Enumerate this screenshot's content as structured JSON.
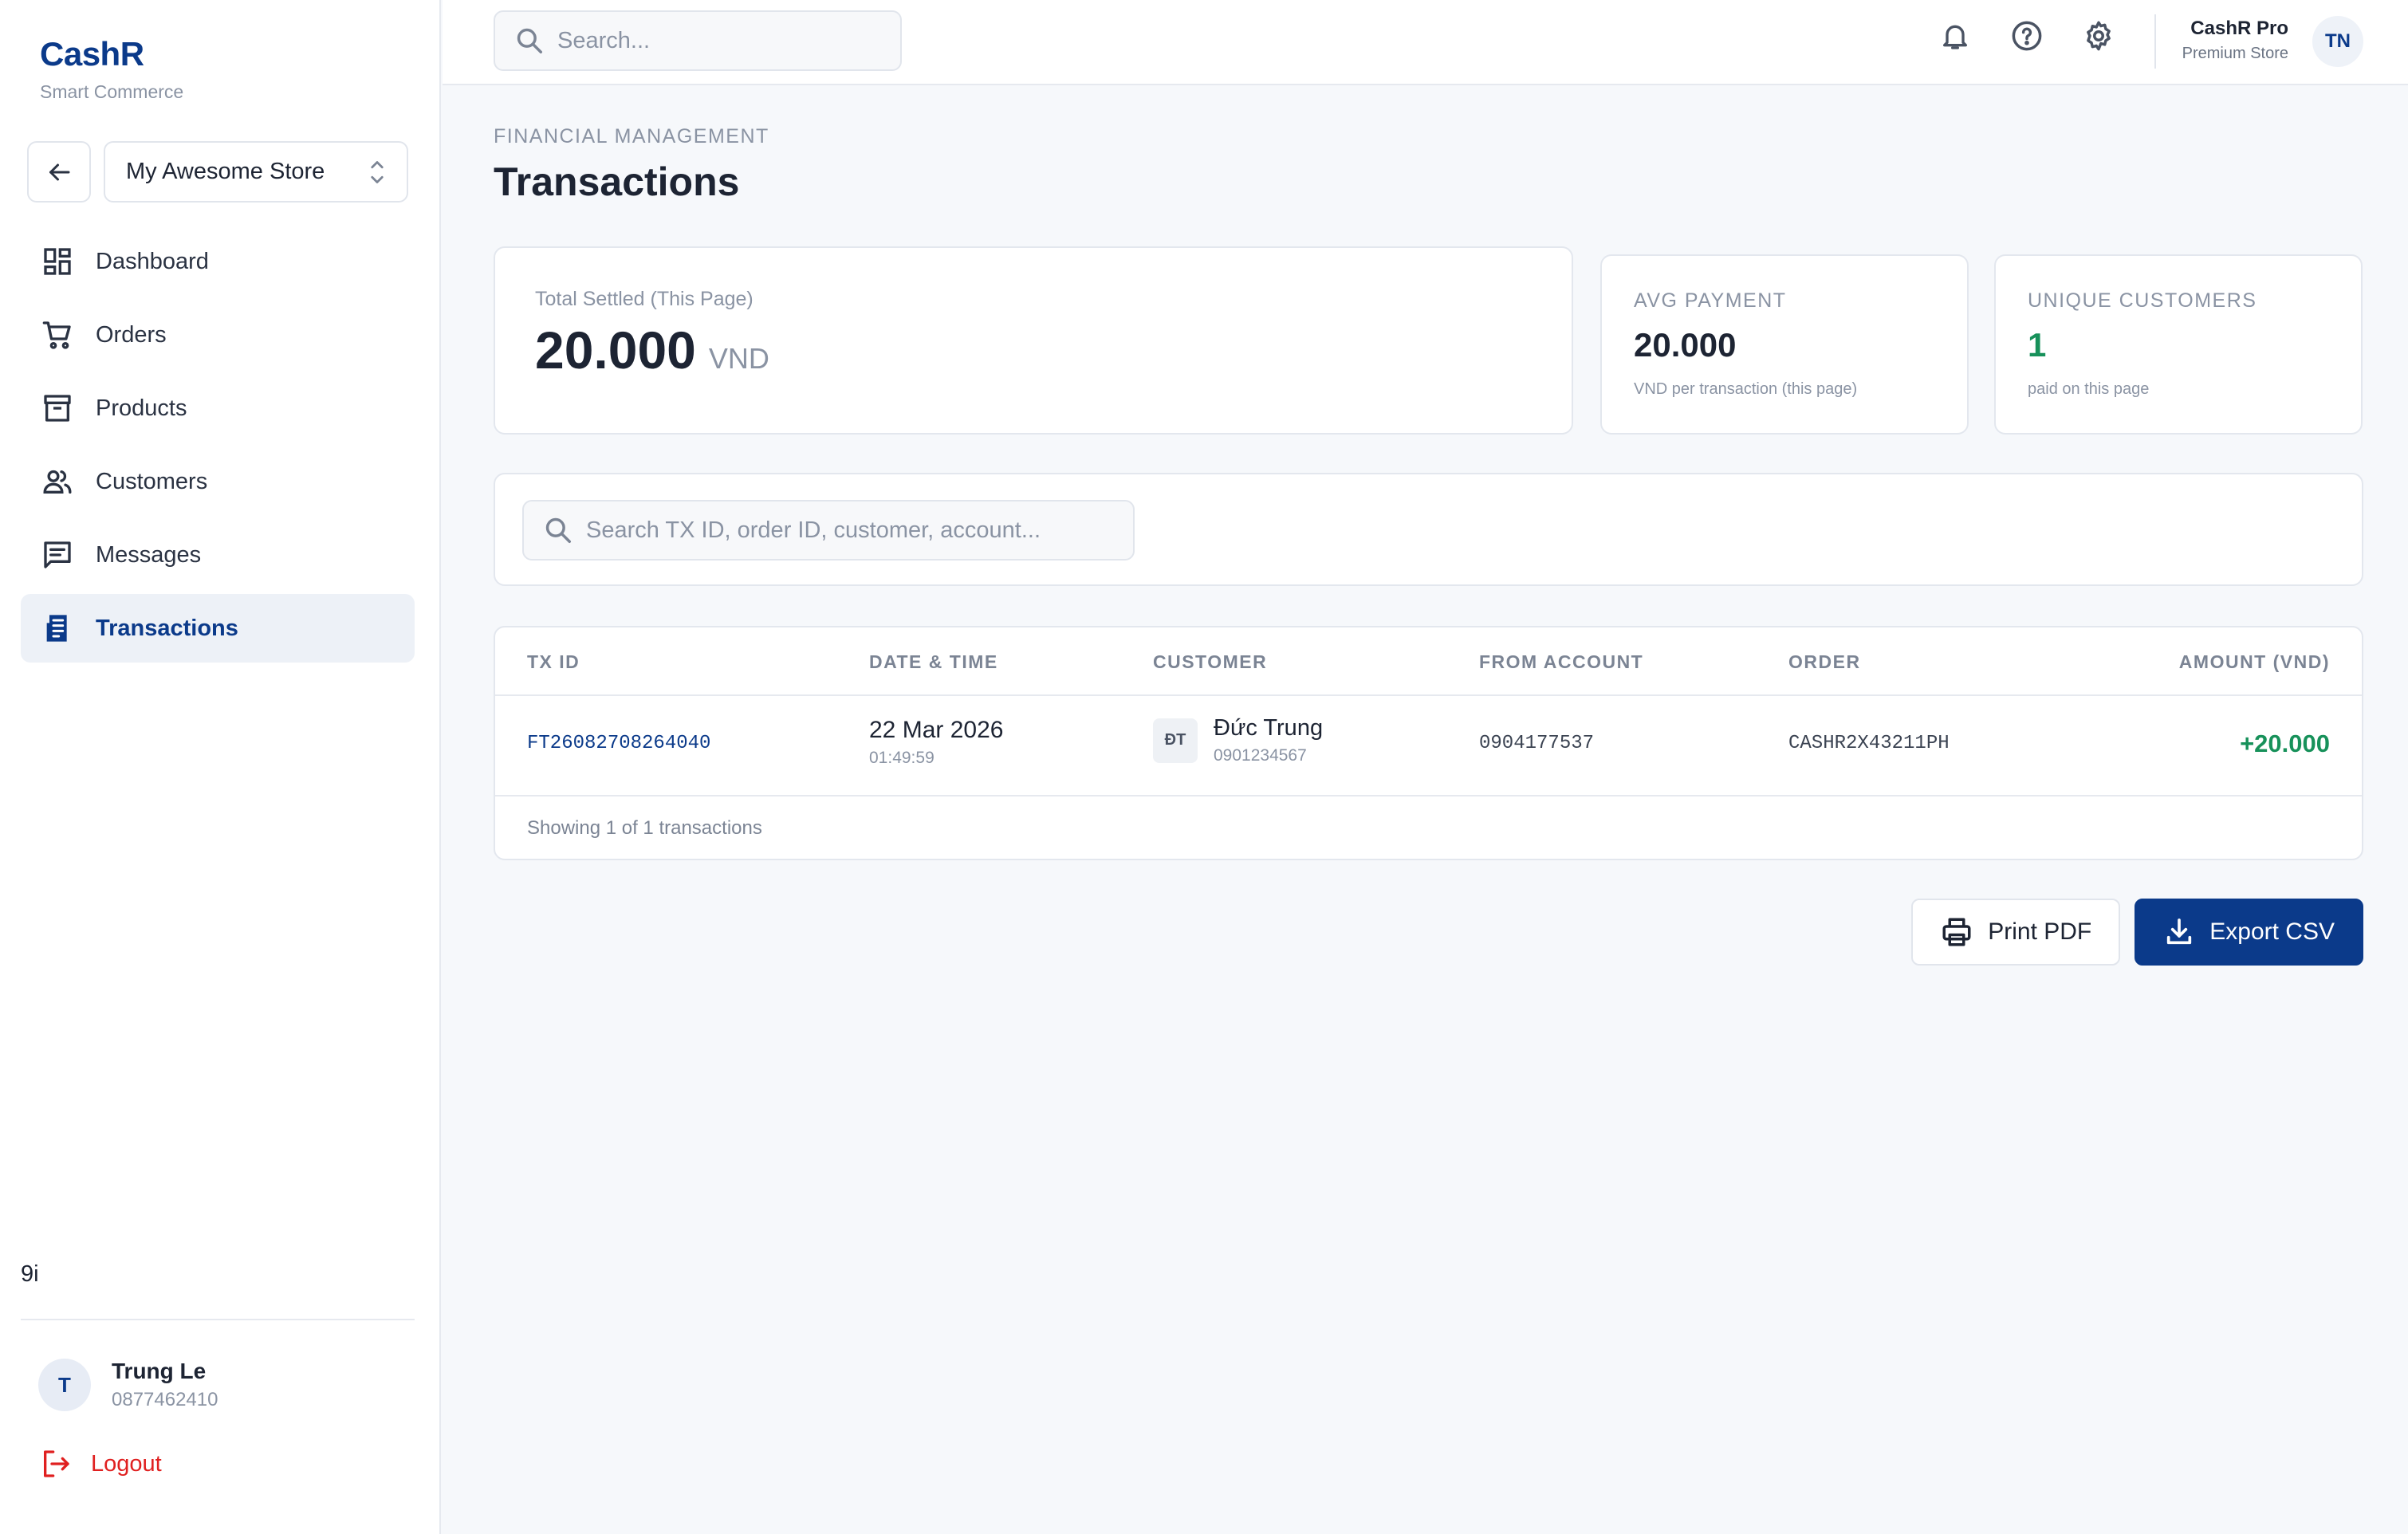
{
  "brand": {
    "name": "CashR",
    "tagline": "Smart Commerce"
  },
  "store": {
    "name": "My Awesome Store"
  },
  "sidebar": {
    "items": [
      {
        "label": "Dashboard",
        "icon": "dashboard-icon"
      },
      {
        "label": "Orders",
        "icon": "cart-icon"
      },
      {
        "label": "Products",
        "icon": "archive-icon"
      },
      {
        "label": "Customers",
        "icon": "people-icon"
      },
      {
        "label": "Messages",
        "icon": "message-icon"
      },
      {
        "label": "Transactions",
        "icon": "receipt-icon",
        "active": true
      }
    ],
    "version_tag": "9i",
    "user": {
      "initial": "T",
      "name": "Trung Le",
      "phone": "0877462410"
    },
    "logout_label": "Logout"
  },
  "topbar": {
    "search_placeholder": "Search...",
    "account": {
      "name": "CashR Pro",
      "tier": "Premium Store",
      "initials": "TN"
    }
  },
  "page": {
    "eyebrow": "FINANCIAL MANAGEMENT",
    "title": "Transactions"
  },
  "stats": {
    "total": {
      "label": "Total Settled (This Page)",
      "value": "20.000",
      "currency": "VND"
    },
    "avg": {
      "label": "AVG PAYMENT",
      "value": "20.000",
      "note": "VND per transaction (this page)"
    },
    "unique": {
      "label": "UNIQUE CUSTOMERS",
      "value": "1",
      "note": "paid on this page"
    }
  },
  "filter": {
    "search_placeholder": "Search TX ID, order ID, customer, account..."
  },
  "table": {
    "headers": {
      "txid": "TX ID",
      "datetime": "DATE & TIME",
      "customer": "CUSTOMER",
      "from": "FROM ACCOUNT",
      "order": "ORDER",
      "amount": "AMOUNT (VND)"
    },
    "rows": [
      {
        "txid": "FT26082708264040",
        "date": "22 Mar 2026",
        "time": "01:49:59",
        "customer_initials": "ĐT",
        "customer_name": "Đức Trung",
        "customer_phone": "0901234567",
        "from_account": "0904177537",
        "order": "CASHR2X43211PH",
        "amount": "+20.000"
      }
    ],
    "footer": "Showing 1 of 1 transactions"
  },
  "actions": {
    "print_label": "Print PDF",
    "export_label": "Export CSV"
  },
  "colors": {
    "brand": "#0b3a8a",
    "positive": "#17915a",
    "danger": "#e02020"
  }
}
